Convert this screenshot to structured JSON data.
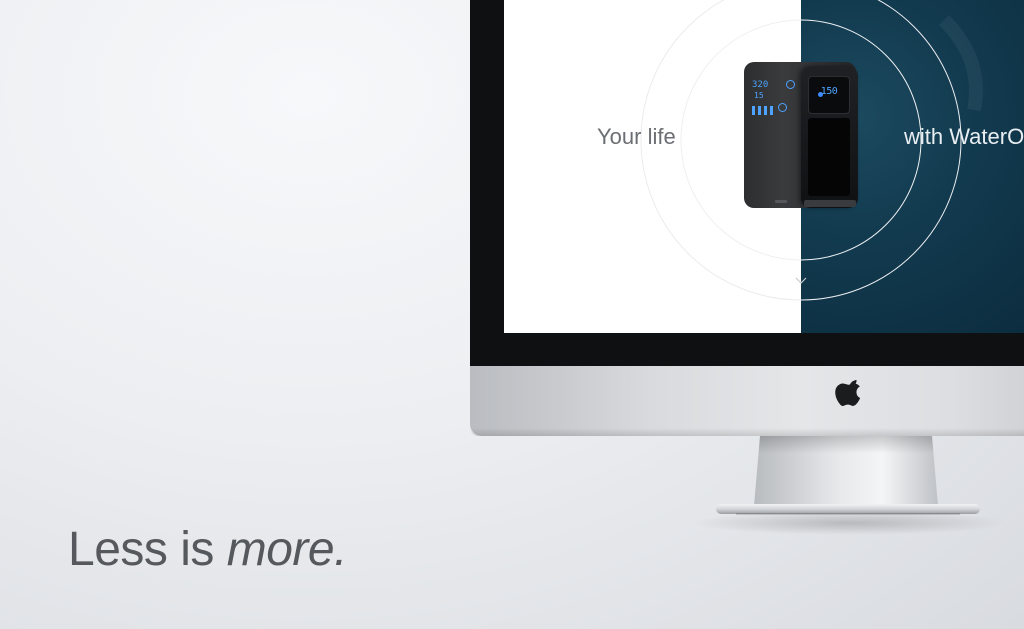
{
  "tagline": {
    "regular": "Less is",
    "emphasis": "more."
  },
  "screen": {
    "left_text": "Your life",
    "right_text": "with WaterO",
    "left_bg": "#ffffff",
    "right_bg": "#123a4f"
  },
  "product": {
    "display_readout": "150",
    "panel_line1": "320",
    "panel_line2": "15"
  },
  "icons": {
    "brand": "apple-logo-icon",
    "scroll": "chevron-down-icon"
  },
  "colors": {
    "background": "#eceef1",
    "tagline_text": "#55595e",
    "bezel": "#0f1012",
    "display_blue": "#4da3ff"
  }
}
